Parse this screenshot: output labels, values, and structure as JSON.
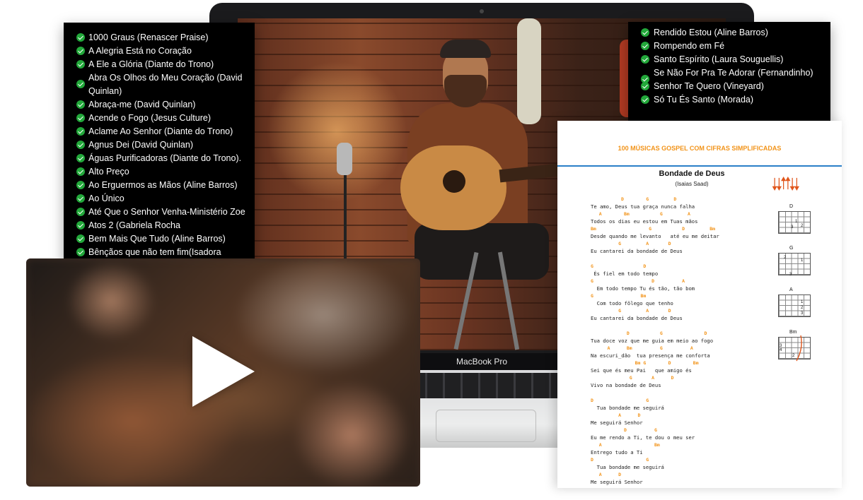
{
  "laptop": {
    "model_label": "MacBook Pro"
  },
  "left_list": {
    "items": [
      "1000 Graus (Renascer Praise)",
      "A Alegria Está no Coração",
      "A Ele a Glória (Diante do Trono)",
      "Abra Os Olhos do Meu Coração (David Quinlan)",
      "Abraça-me (David Quinlan)",
      "Acende o Fogo (Jesus Culture)",
      "Aclame Ao Senhor (Diante do Trono)",
      "Agnus Dei (David Quinlan)",
      "Águas Purificadoras (Diante do Trono).",
      "Alto Preço",
      "Ao Erguermos as Mãos (Aline Barros)",
      "Ao Único",
      "Até Que o Senhor Venha-Ministério Zoe",
      "Atos 2 (Gabriela Rocha",
      "Bem Mais Que Tudo (Aline Barros)",
      "Bênçãos que não tem fim(Isadora"
    ]
  },
  "right_list": {
    "items": [
      "Rendido Estou (Aline Barros)",
      "Rompendo em Fé",
      "Santo Espírito (Laura Souguellis)",
      "Se Não For Pra Te Adorar (Fernandinho)",
      "Senhor Te Quero (Vineyard)",
      "Só Tu És Santo (Morada)"
    ]
  },
  "video": {
    "icon": "play-icon"
  },
  "sheet": {
    "header": "100 MÚSICAS GOSPEL COM CIFRAS SIMPLIFICADAS",
    "title": "Bondade de Deus",
    "artist": "(Isaias Saad)",
    "accent_color": "#f29318",
    "rule_color": "#2a7fc8",
    "strum_icon": "strum-arrows-icon",
    "chord_diagrams": [
      "D",
      "G",
      "A",
      "Bm"
    ],
    "lines": [
      {
        "chords": "           D        G         D",
        "lyric": "Te amo, Deus tua graça nunca falha"
      },
      {
        "chords": "   A        Bm           G         A",
        "lyric": "Todos os dias eu estou em Tuas mãos"
      },
      {
        "chords": "Bm                   G           D         Bm",
        "lyric": "Desde quando me levanto   até eu me deitar"
      },
      {
        "chords": "          G         A       D",
        "lyric": "Eu cantarei da bondade de Deus"
      },
      {
        "gap": true
      },
      {
        "chords": "G                  D",
        "lyric": " És fiel em todo tempo"
      },
      {
        "chords": "G                     D          A",
        "lyric": "  Em todo tempo Tu és tão, tão bom"
      },
      {
        "chords": "G                 Bm",
        "lyric": "  Com todo fôlego que tenho"
      },
      {
        "chords": "          G         A       D",
        "lyric": "Eu cantarei da bondade de Deus"
      },
      {
        "gap": true
      },
      {
        "chords": "             D           G               D",
        "lyric": "Tua doce voz que me guia em meio ao fogo"
      },
      {
        "chords": "      A      Bm          G          A",
        "lyric": "Na escuri_dão  tua presença me conforta"
      },
      {
        "chords": "                Bm G        D        Bm",
        "lyric": "Sei que és meu Pai   que amigo és"
      },
      {
        "chords": "              G       A      D",
        "lyric": "Vivo na bondade de Deus"
      },
      {
        "gap": true
      },
      {
        "chords": "D                   G",
        "lyric": "  Tua bondade me seguirá"
      },
      {
        "chords": "          A      D",
        "lyric": "Me seguirá Senhor"
      },
      {
        "chords": "            D          G",
        "lyric": "Eu me rendo a Ti, te dou o meu ser"
      },
      {
        "chords": "   A                   Bm",
        "lyric": "Entrego tudo a Ti"
      },
      {
        "chords": "D                   G",
        "lyric": "  Tua bondade me seguirá"
      },
      {
        "chords": "   A      D",
        "lyric": "Me seguirá Senhor"
      }
    ]
  }
}
